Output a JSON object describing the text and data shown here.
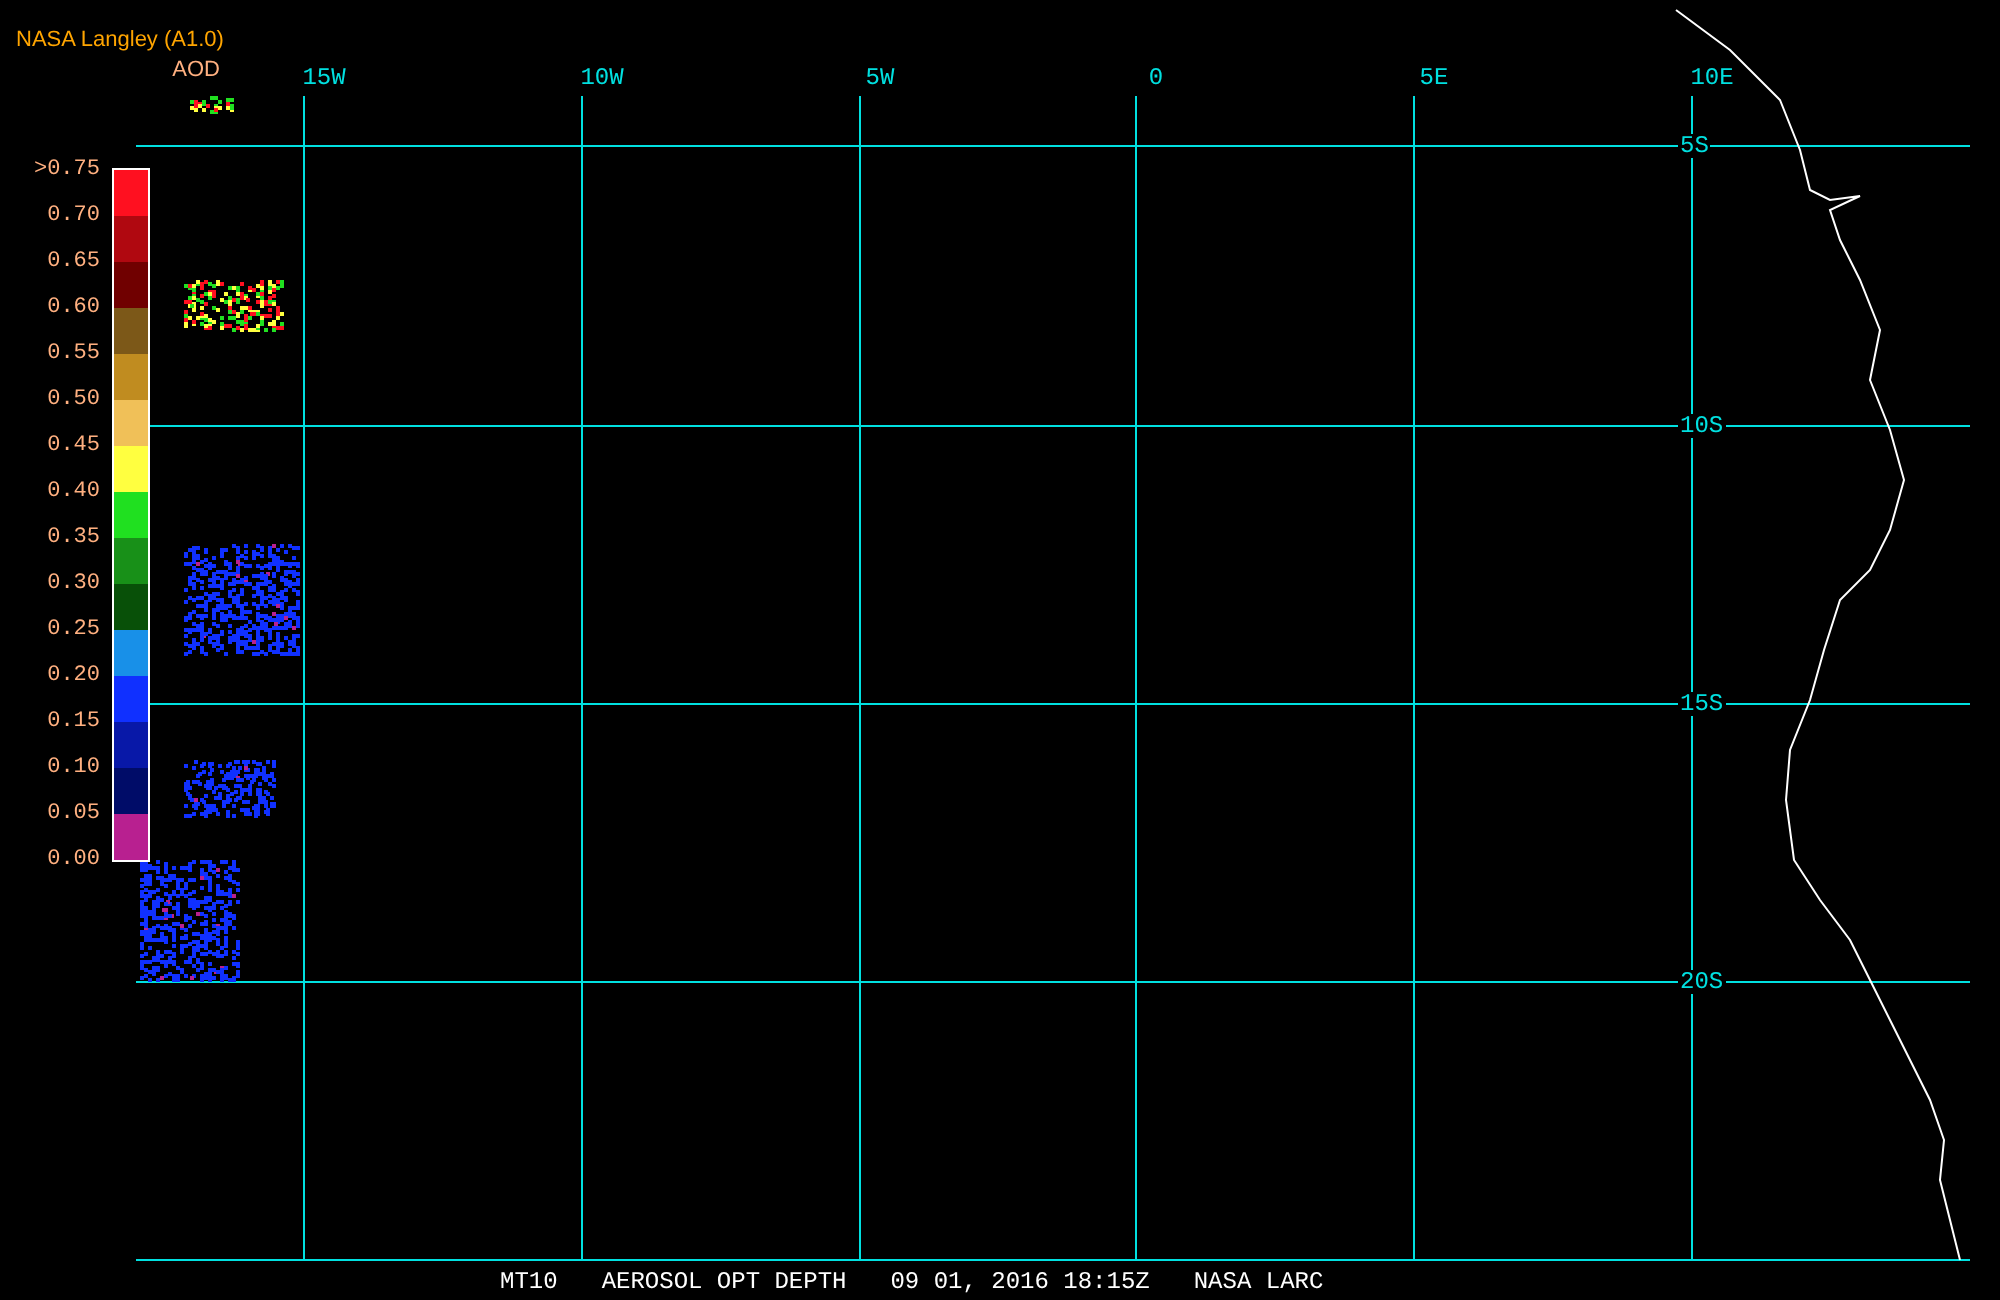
{
  "header": {
    "title": "NASA Langley (A1.0)",
    "legend_title": "AOD"
  },
  "legend": [
    {
      "label": ">0.75",
      "color": "#ff1020"
    },
    {
      "label": "0.70",
      "color": "#b00810"
    },
    {
      "label": "0.65",
      "color": "#700000"
    },
    {
      "label": "0.60",
      "color": "#7c5818"
    },
    {
      "label": "0.55",
      "color": "#c08c20"
    },
    {
      "label": "0.50",
      "color": "#f0c058"
    },
    {
      "label": "0.45",
      "color": "#ffff40"
    },
    {
      "label": "0.40",
      "color": "#20e020"
    },
    {
      "label": "0.35",
      "color": "#189018"
    },
    {
      "label": "0.30",
      "color": "#085008"
    },
    {
      "label": "0.25",
      "color": "#1890e8"
    },
    {
      "label": "0.20",
      "color": "#1030ff"
    },
    {
      "label": "0.15",
      "color": "#0818a8"
    },
    {
      "label": "0.10",
      "color": "#000c68"
    },
    {
      "label": "0.05",
      "color": "#b82090"
    }
  ],
  "legend_bottom_label": "0.00",
  "map": {
    "longitude_labels": [
      "15W",
      "10W",
      "5W",
      "0",
      "5E",
      "10E"
    ],
    "latitude_labels": [
      "5S",
      "10S",
      "15S",
      "20S"
    ]
  },
  "caption": [
    "MT10",
    "AEROSOL OPT DEPTH",
    "09 01, 2016 18:15Z",
    "NASA LARC"
  ]
}
